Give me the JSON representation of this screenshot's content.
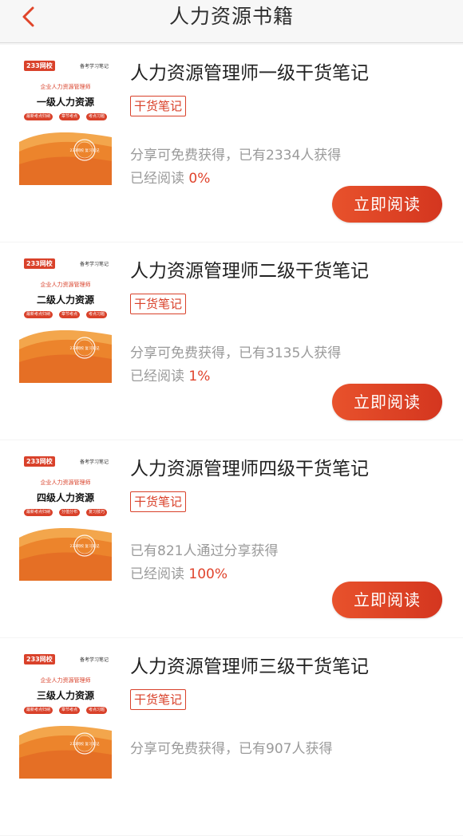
{
  "header": {
    "title": "人力资源书籍",
    "back_icon": "chevron-left-icon"
  },
  "colors": {
    "accent": "#d9412a",
    "button": "#e0452a",
    "cover_orange": "#ef8a2c"
  },
  "books": [
    {
      "title": "人力资源管理师一级干货笔记",
      "tag": "干货笔记",
      "share_text": "分享可免费获得，已有2334人获得",
      "progress_label": "已经阅读 ",
      "progress_value": "0%",
      "button": "立即阅读",
      "cover": {
        "logo": "233网校",
        "tagline": "备考学习笔记",
        "subtitle": "企业人力资源管理师",
        "title": "一级人力资源",
        "pills": [
          "最新考点归纳",
          "章节考点",
          "考点习题"
        ],
        "stamp": "233网校 复习笔记"
      }
    },
    {
      "title": "人力资源管理师二级干货笔记",
      "tag": "干货笔记",
      "share_text": "分享可免费获得，已有3135人获得",
      "progress_label": "已经阅读 ",
      "progress_value": "1%",
      "button": "立即阅读",
      "cover": {
        "logo": "233网校",
        "tagline": "备考学习笔记",
        "subtitle": "企业人力资源管理师",
        "title": "二级人力资源",
        "pills": [
          "最新考点归纳",
          "章节考点",
          "考点习题"
        ],
        "stamp": "233网校 复习笔记"
      }
    },
    {
      "title": "人力资源管理师四级干货笔记",
      "tag": "干货笔记",
      "share_text": "已有821人通过分享获得",
      "progress_label": "已经阅读 ",
      "progress_value": "100%",
      "button": "立即阅读",
      "cover": {
        "logo": "233网校",
        "tagline": "备考学习笔记",
        "subtitle": "企业人力资源管理师",
        "title": "四级人力资源",
        "pills": [
          "最新考点归纳",
          "分值分布",
          "复习技巧"
        ],
        "stamp": "233网校 复习笔记"
      }
    },
    {
      "title": "人力资源管理师三级干货笔记",
      "tag": "干货笔记",
      "share_text": "分享可免费获得，已有907人获得",
      "progress_label": "",
      "progress_value": "",
      "button": "",
      "cover": {
        "logo": "233网校",
        "tagline": "备考学习笔记",
        "subtitle": "企业人力资源管理师",
        "title": "三级人力资源",
        "pills": [
          "最新考点归纳",
          "章节考点",
          "考点习题"
        ],
        "stamp": "233网校 复习笔记"
      }
    }
  ]
}
